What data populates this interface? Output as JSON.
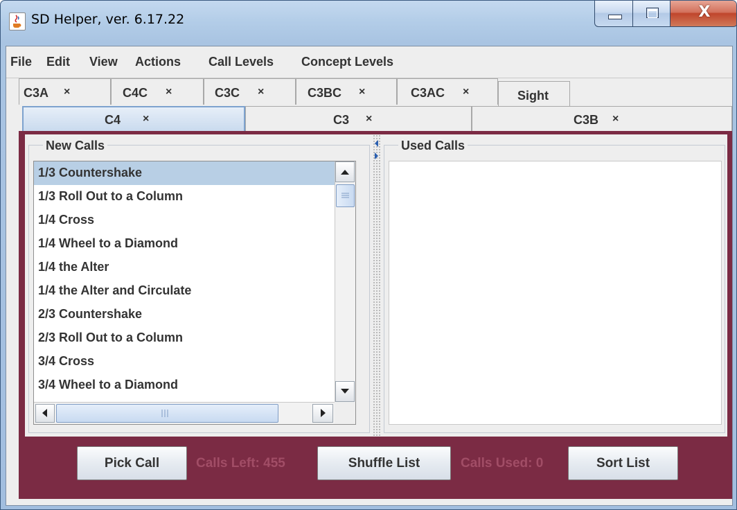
{
  "window": {
    "title": "SD Helper, ver. 6.17.22",
    "close_glyph": "X"
  },
  "menu": [
    "File",
    "Edit",
    "View",
    "Actions",
    "Call Levels",
    "Concept Levels"
  ],
  "tabs_row1": [
    {
      "label": "C3A",
      "closable": true
    },
    {
      "label": "C4C",
      "closable": true
    },
    {
      "label": "C3C",
      "closable": true
    },
    {
      "label": "C3BC",
      "closable": true
    },
    {
      "label": "C3AC",
      "closable": true
    },
    {
      "label": "Sight",
      "closable": false
    }
  ],
  "tabs_row2": [
    {
      "label": "C4",
      "closable": true,
      "selected": true
    },
    {
      "label": "C3",
      "closable": true,
      "selected": false
    },
    {
      "label": "C3B",
      "closable": true,
      "selected": false
    }
  ],
  "close_mark": "×",
  "new_calls": {
    "title": "New Calls",
    "selected_index": 0,
    "items": [
      "1/3 Countershake",
      "1/3 Roll Out to a Column",
      "1/4 Cross",
      "1/4 Wheel to a Diamond",
      "1/4 the Alter",
      "1/4 the Alter and Circulate",
      "2/3 Countershake",
      "2/3 Roll Out to a Column",
      "3/4 Cross",
      "3/4 Wheel to a Diamond"
    ]
  },
  "used_calls": {
    "title": "Used Calls",
    "items": []
  },
  "actions": {
    "pick_label": "Pick Call",
    "calls_left": "Calls Left: 455",
    "shuffle_label": "Shuffle List",
    "calls_used": "Calls Used: 0",
    "sort_label": "Sort List"
  },
  "colors": {
    "panel_bg": "#7b2b44",
    "status_text": "#a14d66",
    "selection": "#b8cfe5"
  }
}
